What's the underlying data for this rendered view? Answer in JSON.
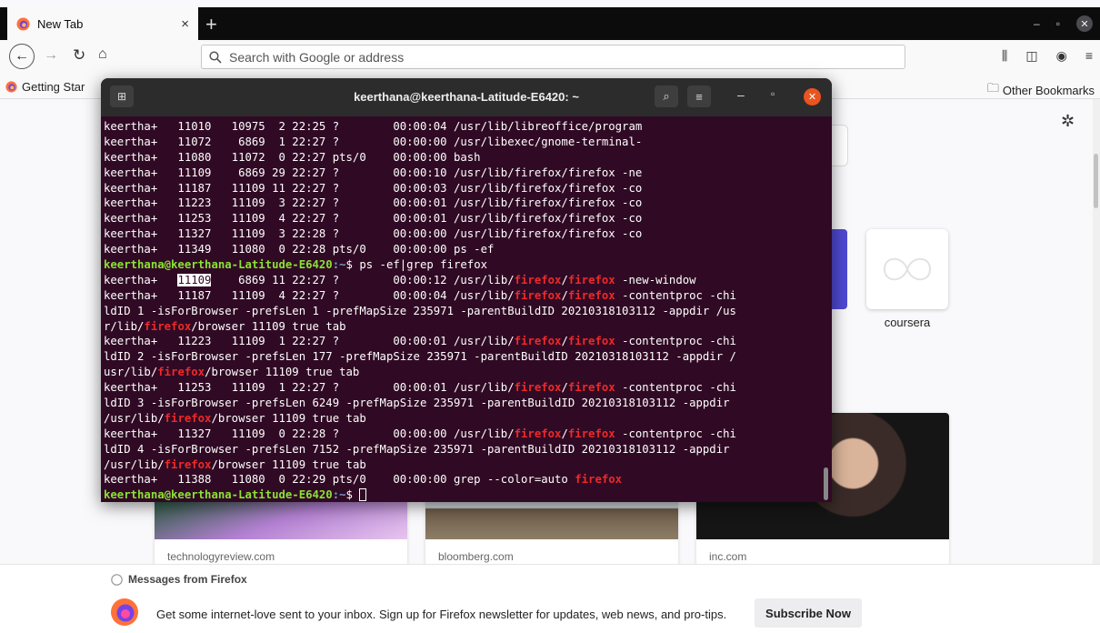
{
  "browser": {
    "tab_title": "New Tab",
    "tab_close": "×",
    "new_tab": "+",
    "url_placeholder": "Search with Google or address",
    "bookmark_getting_started": "Getting Star",
    "bookmark_other": "Other Bookmarks",
    "window_minimize": "–",
    "window_restore": "▫",
    "window_close": "✕"
  },
  "newtab": {
    "top_site_dots": "..",
    "top_site_label": "coursera",
    "cards": [
      {
        "source": "technologyreview.com"
      },
      {
        "source": "bloomberg.com"
      },
      {
        "source": "inc.com"
      }
    ],
    "messages_heading": "Messages from Firefox",
    "message_text": "Get some internet-love sent to your inbox. Sign up for Firefox newsletter for updates, web news, and pro-tips.",
    "subscribe_label": "Subscribe Now"
  },
  "terminal": {
    "title": "keerthana@keerthana-Latitude-E6420: ~",
    "prompt_user": "keerthana@keerthana-Latitude-E6420",
    "prompt_path": ":~",
    "prompt_sym": "$ ",
    "lines": [
      "keertha+   11010   10975  2 22:25 ?        00:00:04 /usr/lib/libreoffice/program",
      "keertha+   11072    6869  1 22:27 ?        00:00:00 /usr/libexec/gnome-terminal-",
      "keertha+   11080   11072  0 22:27 pts/0    00:00:00 bash",
      "keertha+   11109    6869 29 22:27 ?        00:00:10 /usr/lib/firefox/firefox -ne",
      "keertha+   11187   11109 11 22:27 ?        00:00:03 /usr/lib/firefox/firefox -co",
      "keertha+   11223   11109  3 22:27 ?        00:00:01 /usr/lib/firefox/firefox -co",
      "keertha+   11253   11109  4 22:27 ?        00:00:01 /usr/lib/firefox/firefox -co",
      "keertha+   11327   11109  3 22:28 ?        00:00:00 /usr/lib/firefox/firefox -co",
      "keertha+   11349   11080  0 22:28 pts/0    00:00:00 ps -ef"
    ],
    "command": "ps -ef|grep firefox",
    "grep_word": "firefox",
    "grep_lines": [
      [
        {
          "t": "keertha+   "
        },
        {
          "t": "11109",
          "sel": true
        },
        {
          "t": "    6869 11 22:27 ?        00:00:12 /usr/lib/"
        },
        {
          "t": "firefox",
          "hl": true
        },
        {
          "t": "/"
        },
        {
          "t": "firefox",
          "hl": true
        },
        {
          "t": " -new-window"
        }
      ],
      [
        {
          "t": "keertha+   11187   11109  4 22:27 ?        00:00:04 /usr/lib/"
        },
        {
          "t": "firefox",
          "hl": true
        },
        {
          "t": "/"
        },
        {
          "t": "firefox",
          "hl": true
        },
        {
          "t": " -contentproc -chi"
        }
      ],
      [
        {
          "t": "ldID 1 -isForBrowser -prefsLen 1 -prefMapSize 235971 -parentBuildID 20210318103112 -appdir /us"
        }
      ],
      [
        {
          "t": "r/lib/"
        },
        {
          "t": "firefox",
          "hl": true
        },
        {
          "t": "/browser 11109 true tab"
        }
      ],
      [
        {
          "t": "keertha+   11223   11109  1 22:27 ?        00:00:01 /usr/lib/"
        },
        {
          "t": "firefox",
          "hl": true
        },
        {
          "t": "/"
        },
        {
          "t": "firefox",
          "hl": true
        },
        {
          "t": " -contentproc -chi"
        }
      ],
      [
        {
          "t": "ldID 2 -isForBrowser -prefsLen 177 -prefMapSize 235971 -parentBuildID 20210318103112 -appdir /"
        }
      ],
      [
        {
          "t": "usr/lib/"
        },
        {
          "t": "firefox",
          "hl": true
        },
        {
          "t": "/browser 11109 true tab"
        }
      ],
      [
        {
          "t": "keertha+   11253   11109  1 22:27 ?        00:00:01 /usr/lib/"
        },
        {
          "t": "firefox",
          "hl": true
        },
        {
          "t": "/"
        },
        {
          "t": "firefox",
          "hl": true
        },
        {
          "t": " -contentproc -chi"
        }
      ],
      [
        {
          "t": "ldID 3 -isForBrowser -prefsLen 6249 -prefMapSize 235971 -parentBuildID 20210318103112 -appdir"
        }
      ],
      [
        {
          "t": "/usr/lib/"
        },
        {
          "t": "firefox",
          "hl": true
        },
        {
          "t": "/browser 11109 true tab"
        }
      ],
      [
        {
          "t": "keertha+   11327   11109  0 22:28 ?        00:00:00 /usr/lib/"
        },
        {
          "t": "firefox",
          "hl": true
        },
        {
          "t": "/"
        },
        {
          "t": "firefox",
          "hl": true
        },
        {
          "t": " -contentproc -chi"
        }
      ],
      [
        {
          "t": "ldID 4 -isForBrowser -prefsLen 7152 -prefMapSize 235971 -parentBuildID 20210318103112 -appdir"
        }
      ],
      [
        {
          "t": "/usr/lib/"
        },
        {
          "t": "firefox",
          "hl": true
        },
        {
          "t": "/browser 11109 true tab"
        }
      ],
      [
        {
          "t": "keertha+   11388   11080  0 22:29 pts/0    00:00:00 grep --color=auto "
        },
        {
          "t": "firefox",
          "hl": true
        }
      ]
    ]
  },
  "colors": {
    "terminal_bg": "#300a24",
    "prompt_green": "#8ae234",
    "prompt_blue": "#729fcf",
    "match_red": "#ef2929",
    "ubuntu_orange": "#e95420"
  }
}
